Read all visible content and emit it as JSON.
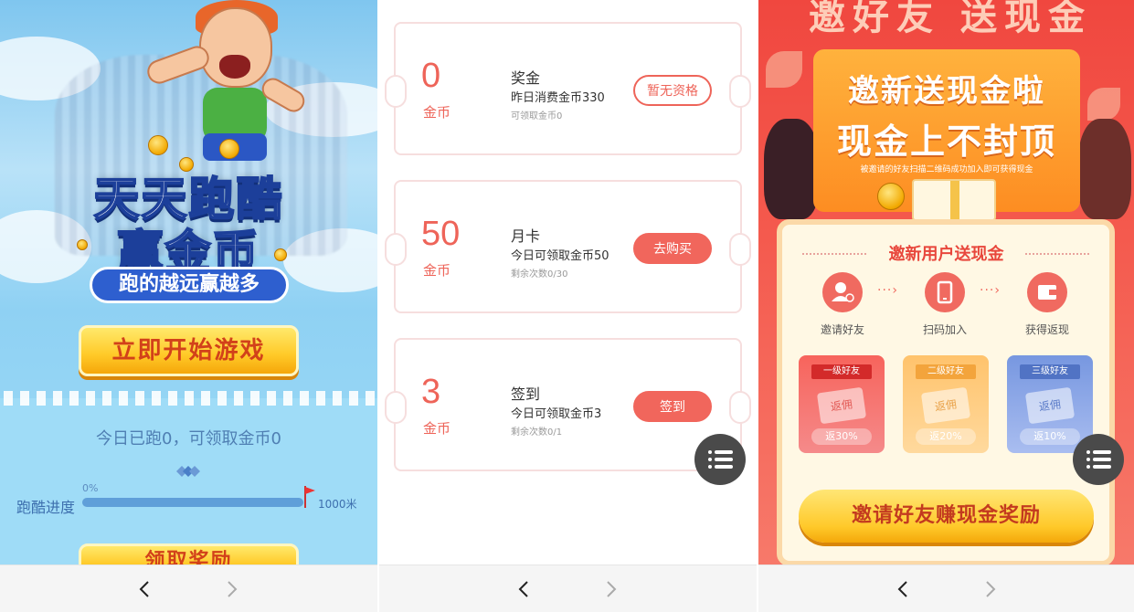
{
  "panel1": {
    "title_line1": "天天跑酷",
    "title_line2": "赢金币",
    "slogan": "跑的越远赢越多",
    "start_button": "立即开始游戏",
    "status": "今日已跑0，可领取金币0",
    "progress_label": "跑酷进度",
    "progress_percent": "0%",
    "progress_value": 0,
    "progress_max": "1000米",
    "second_button": "领取奖励"
  },
  "panel2": {
    "tickets": [
      {
        "amount": "0",
        "unit": "金币",
        "title": "奖金",
        "desc": "昨日消费金币330",
        "sub": "可领取金币0",
        "button": "暂无资格",
        "style": "outline"
      },
      {
        "amount": "50",
        "unit": "金币",
        "title": "月卡",
        "desc": "今日可领取金币50",
        "sub": "剩余次数0/30",
        "button": "去购买",
        "style": "solid"
      },
      {
        "amount": "3",
        "unit": "金币",
        "title": "签到",
        "desc": "今日可领取金币3",
        "sub": "剩余次数0/1",
        "button": "签到",
        "style": "solid"
      }
    ]
  },
  "panel3": {
    "top_title": "邀好友 送现金",
    "banner_line1": "邀新送现金啦",
    "banner_line2": "现金上不封顶",
    "banner_note": "被邀请的好友扫描二维码成功加入即可获得现金",
    "card_title": "邀新用户送现金",
    "steps": [
      {
        "label": "邀请好友",
        "icon": "user-add-icon"
      },
      {
        "label": "扫码加入",
        "icon": "phone-icon"
      },
      {
        "label": "获得返现",
        "icon": "wallet-icon"
      }
    ],
    "tiers": [
      {
        "tag": "一级好友",
        "ticket": "返佣",
        "pct": "返30%",
        "color": "#f0514a"
      },
      {
        "tag": "二级好友",
        "ticket": "返佣",
        "pct": "返20%",
        "color": "#fcb860"
      },
      {
        "tag": "三级好友",
        "ticket": "返佣",
        "pct": "返10%",
        "color": "#6f90d8"
      }
    ],
    "invite_button": "邀请好友赚现金奖励"
  },
  "nav": {
    "back_icon": "chevron-left-icon",
    "forward_icon": "chevron-right-icon"
  },
  "colors": {
    "accent_red": "#ee6459",
    "button_yellow": "#ffc927",
    "sky_blue": "#9fdcf7"
  }
}
